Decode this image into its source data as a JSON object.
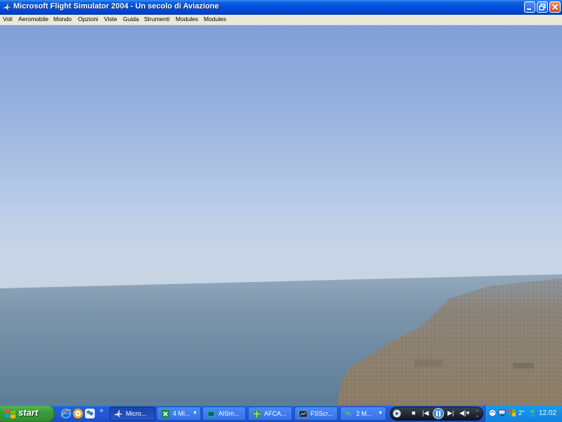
{
  "window": {
    "title": "Microsoft Flight Simulator 2004 - Un secolo di Aviazione",
    "icon": "airplane-icon"
  },
  "menu": {
    "items": [
      "Voli",
      "Aeromobile",
      "Mondo",
      "Opzioni",
      "Viste",
      "Guida",
      "Strumenti",
      "Modules",
      "Modules"
    ]
  },
  "taskbar": {
    "start_label": "start",
    "quick_launch": [
      "internet-explorer-icon",
      "media-player-icon",
      "messenger-icon"
    ],
    "quick_launch_more": "»",
    "tasks": [
      {
        "label": "Micro...",
        "icon": "airplane-icon",
        "active": true
      },
      {
        "label": "4 Mi...",
        "icon": "excel-icon",
        "grouped": true
      },
      {
        "label": "AISm...",
        "icon": "app-icon"
      },
      {
        "label": "AFCA...",
        "icon": "network-icon"
      },
      {
        "label": "FSScr...",
        "icon": "camera-icon"
      },
      {
        "label": "2 M...",
        "icon": "messenger-icon",
        "grouped": true
      }
    ],
    "media_controls": [
      "stop-icon",
      "previous-icon",
      "pause-icon",
      "next-icon",
      "volume-icon"
    ],
    "tray": {
      "temperature": "2°",
      "clock": "12.02"
    }
  },
  "colors": {
    "sky_top": "#86a4dc",
    "sky_horizon": "#c8d7e8",
    "sea": "#6b8aa4",
    "land": "#8a8070"
  }
}
